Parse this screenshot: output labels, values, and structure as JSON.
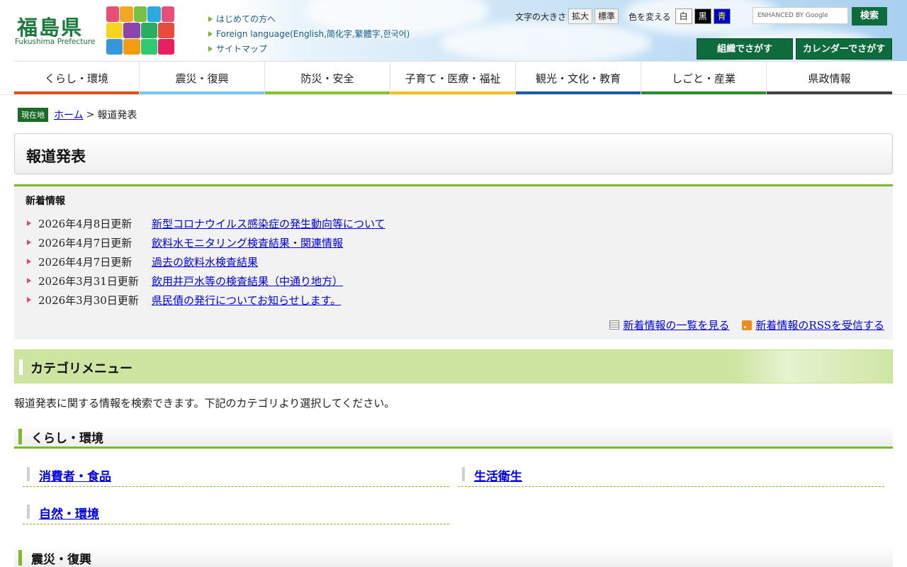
{
  "header": {
    "logo": "福島県",
    "logo_sub": "Fukushima Prefecture",
    "slogan_alt": "ひとつ、ひとつ、実現する ふくしま",
    "links": [
      "はじめての方へ",
      "Foreign language(English,简化字,繁體字,한국어)",
      "サイトマップ"
    ],
    "text_size_label": "文字の大きさ",
    "enlarge": "拡大",
    "standard": "標準",
    "color_label": "色を変える",
    "colors": [
      "白",
      "黒",
      "青"
    ],
    "search_placeholder": "ENHANCED BY Google",
    "search_button": "検索",
    "org_search": "組織でさがす",
    "calendar_search": "カレンダーでさがす"
  },
  "nav": [
    {
      "label": "くらし・環境",
      "color": "#e0501f"
    },
    {
      "label": "震災・復興",
      "color": "#7dc6ea"
    },
    {
      "label": "防災・安全",
      "color": "#89c230"
    },
    {
      "label": "子育て・医療・福祉",
      "color": "#f0c21b"
    },
    {
      "label": "観光・文化・教育",
      "color": "#1f5aa8"
    },
    {
      "label": "しごと・産業",
      "color": "#2e8a30"
    },
    {
      "label": "県政情報",
      "color": "#444444"
    }
  ],
  "breadcrumb": {
    "badge": "現在地",
    "home": "ホーム",
    "sep": ">",
    "current": "報道発表"
  },
  "page_title": "報道発表",
  "news": {
    "heading": "新着情報",
    "items": [
      {
        "date": "2026年4月8日更新",
        "title": "新型コロナウイルス感染症の発生動向等について"
      },
      {
        "date": "2026年4月7日更新",
        "title": "飲料水モニタリング検査結果・関連情報"
      },
      {
        "date": "2026年4月7日更新",
        "title": "過去の飲料水検査結果"
      },
      {
        "date": "2026年3月31日更新",
        "title": "飲用井戸水等の検査結果（中通り地方）"
      },
      {
        "date": "2026年3月30日更新",
        "title": "県民債の発行についてお知らせします。"
      }
    ],
    "list_link": "新着情報の一覧を見る",
    "rss_link": "新着情報のRSSを受信する"
  },
  "category": {
    "heading": "カテゴリメニュー",
    "intro": "報道発表に関する情報を検索できます。下記のカテゴリより選択してください。",
    "sections": [
      {
        "title": "くらし・環境",
        "links": [
          "消費者・食品",
          "生活衛生",
          "自然・環境"
        ]
      },
      {
        "title": "震災・復興",
        "links": []
      }
    ]
  }
}
